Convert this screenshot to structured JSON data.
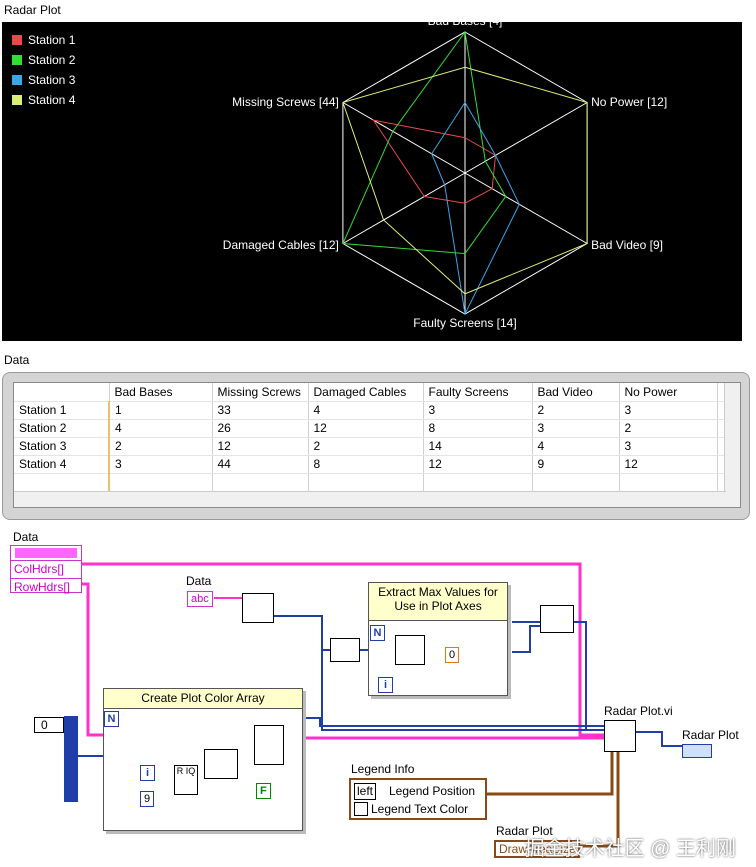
{
  "panel": {
    "radar_title": "Radar Plot",
    "data_title": "Data"
  },
  "chart_data": {
    "type": "radar",
    "axes": [
      {
        "label": "Bad Bases [4]",
        "max": 4
      },
      {
        "label": "No Power [12]",
        "max": 12
      },
      {
        "label": "Bad Video [9]",
        "max": 9
      },
      {
        "label": "Faulty Screens [14]",
        "max": 14
      },
      {
        "label": "Damaged Cables [12]",
        "max": 12
      },
      {
        "label": "Missing Screws [44]",
        "max": 44
      }
    ],
    "series": [
      {
        "name": "Station 1",
        "color": "#e84a4a",
        "values": [
          1,
          3,
          2,
          3,
          4,
          33
        ]
      },
      {
        "name": "Station 2",
        "color": "#33dd33",
        "values": [
          4,
          2,
          3,
          8,
          12,
          26
        ]
      },
      {
        "name": "Station 3",
        "color": "#3aa6e6",
        "values": [
          2,
          3,
          4,
          14,
          2,
          12
        ]
      },
      {
        "name": "Station 4",
        "color": "#d8f07a",
        "values": [
          3,
          12,
          9,
          12,
          8,
          44
        ]
      }
    ],
    "background": "#000000",
    "grid_color": "#ffffff",
    "legend_position": "top-left"
  },
  "table": {
    "columns": [
      "Bad Bases",
      "Missing Screws",
      "Damaged Cables",
      "Faulty Screens",
      "Bad Video",
      "No Power"
    ],
    "rows": [
      {
        "header": "Station 1",
        "cells": [
          "1",
          "33",
          "4",
          "3",
          "2",
          "3"
        ]
      },
      {
        "header": "Station 2",
        "cells": [
          "4",
          "26",
          "12",
          "8",
          "3",
          "2"
        ]
      },
      {
        "header": "Station 3",
        "cells": [
          "2",
          "12",
          "2",
          "14",
          "4",
          "3"
        ]
      },
      {
        "header": "Station 4",
        "cells": [
          "3",
          "44",
          "8",
          "12",
          "9",
          "12"
        ]
      }
    ]
  },
  "diagram": {
    "data_cluster_label": "Data",
    "col_hdrs": "ColHdrs[]",
    "row_hdrs": "RowHdrs[]",
    "data_const_label": "Data",
    "abc_const": "abc",
    "extract_loop_title": "Extract Max Values for Use in Plot Axes",
    "zero_const": "0",
    "color_loop_title": "Create Plot Color Array",
    "index_const": "0",
    "nine_const": "9",
    "n_term": "N",
    "i_term": "i",
    "f_const": "F",
    "quotient_label": "R IQ",
    "radar_vi_label": "Radar Plot.vi",
    "radar_indicator_label": "Radar Plot",
    "legend_info_label": "Legend Info",
    "legend_ring": "left",
    "legend_position": "Legend Position",
    "legend_text_color": "Legend Text Color",
    "draw_area_size": "DrawAreaSize",
    "radar_plot_overlap": "Radar Plot"
  },
  "watermark": "掘金技术社区 @ 王利刚"
}
